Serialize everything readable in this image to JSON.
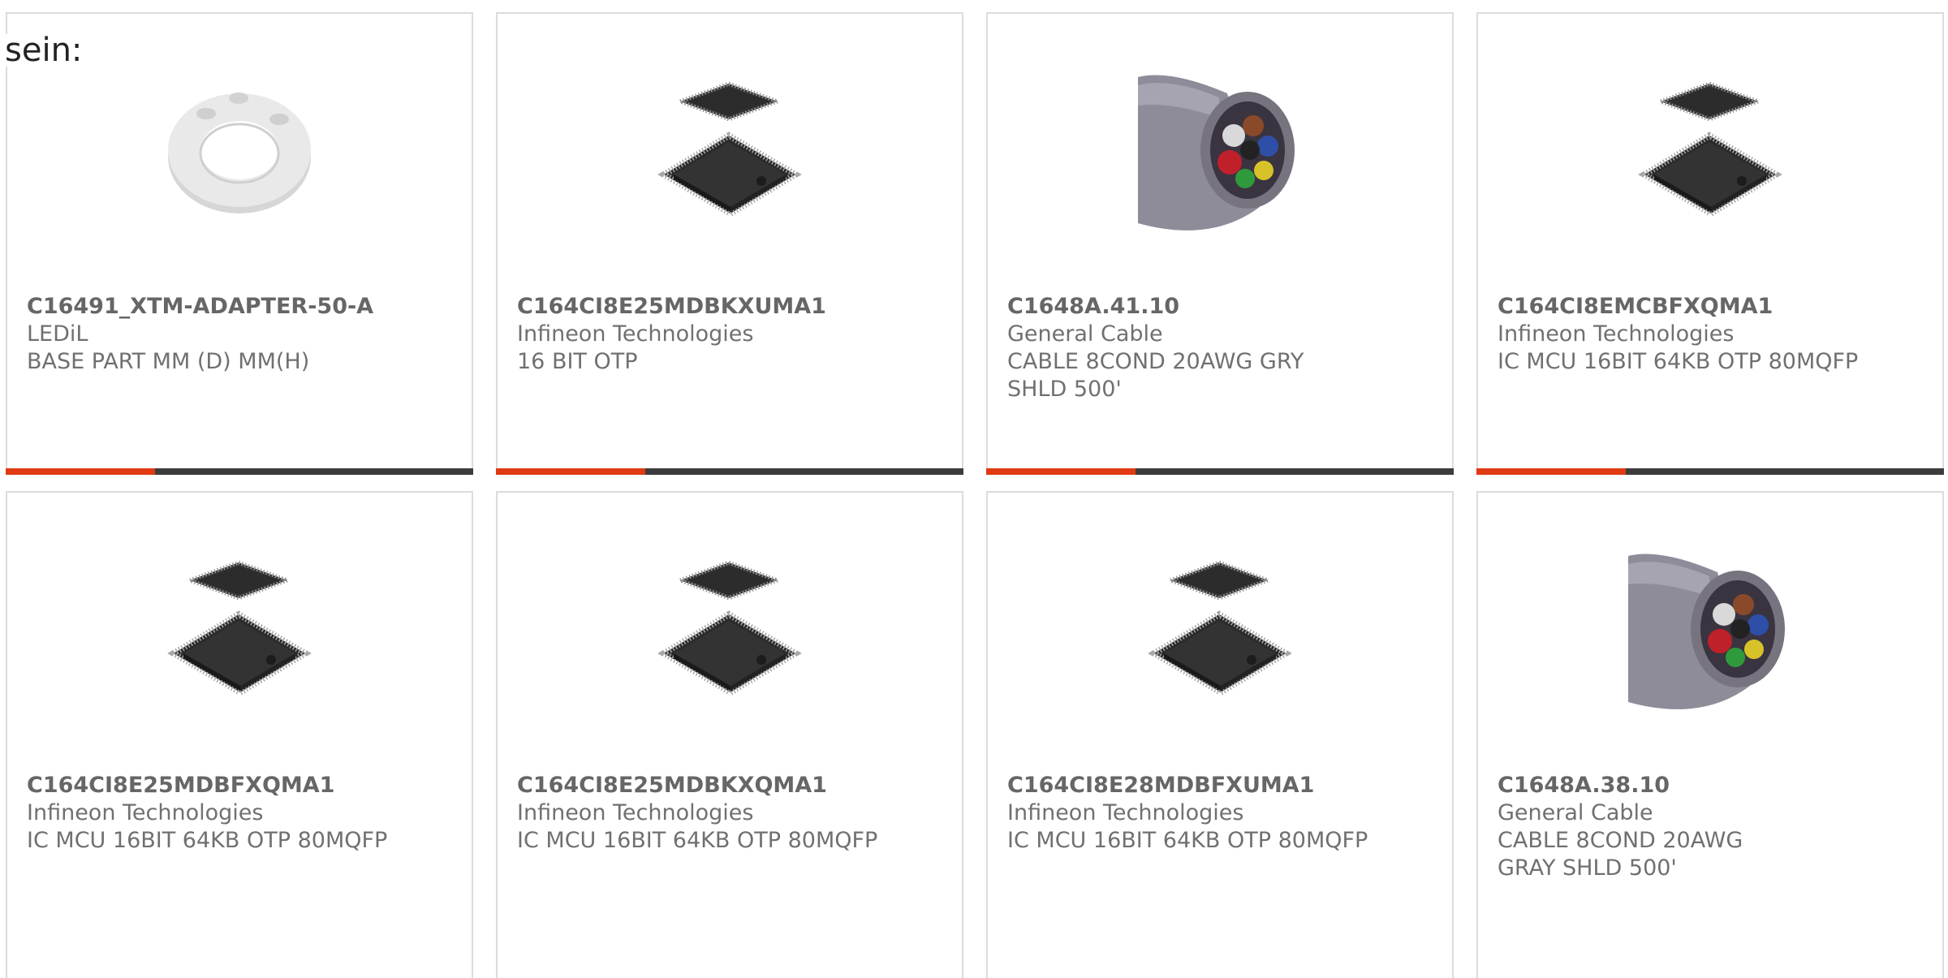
{
  "intro_text": "sein:",
  "products": [
    {
      "part": "C16491_XTM-ADAPTER-50-A",
      "manufacturer": "LEDiL",
      "description": "BASE PART MM (D) MM(H)",
      "image": "led-adapter-ring-image"
    },
    {
      "part": "C164CI8E25MDBKXUMA1",
      "manufacturer": "Infineon Technologies",
      "description": "16 BIT OTP",
      "image": "ic-chip-image"
    },
    {
      "part": "C1648A.41.10",
      "manufacturer": "General Cable",
      "description": "CABLE 8COND 20AWG GRY SHLD 500'",
      "image": "cable-image"
    },
    {
      "part": "C164CI8EMCBFXQMA1",
      "manufacturer": "Infineon Technologies",
      "description": "IC MCU 16BIT 64KB OTP 80MQFP",
      "image": "ic-chip-image"
    },
    {
      "part": "C164CI8E25MDBFXQMA1",
      "manufacturer": "Infineon Technologies",
      "description": "IC MCU 16BIT 64KB OTP 80MQFP",
      "image": "ic-chip-image"
    },
    {
      "part": "C164CI8E25MDBKXQMA1",
      "manufacturer": "Infineon Technologies",
      "description": "IC MCU 16BIT 64KB OTP 80MQFP",
      "image": "ic-chip-image"
    },
    {
      "part": "C164CI8E28MDBFXUMA1",
      "manufacturer": "Infineon Technologies",
      "description": "IC MCU 16BIT 64KB OTP 80MQFP",
      "image": "ic-chip-image"
    },
    {
      "part": "C1648A.38.10",
      "manufacturer": "General Cable",
      "description": "CABLE 8COND 20AWG GRAY SHLD 500'",
      "image": "cable-image"
    }
  ],
  "colors": {
    "accent": "#e03a12",
    "bar": "#3c3c3c",
    "border": "#dcdcdc",
    "text": "#707070"
  }
}
